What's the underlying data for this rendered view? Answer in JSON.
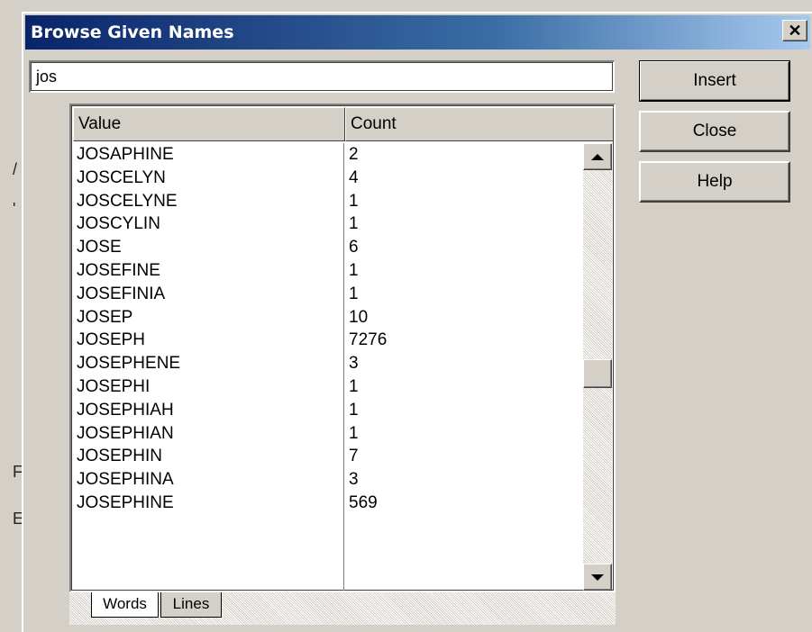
{
  "window": {
    "title": "Browse Given Names",
    "close_glyph": "✕"
  },
  "search": {
    "value": "jos"
  },
  "buttons": {
    "insert": "Insert",
    "close": "Close",
    "help": "Help"
  },
  "table": {
    "columns": [
      "Value",
      "Count"
    ],
    "rows": [
      [
        "JOSAPHINE",
        "2"
      ],
      [
        "JOSCELYN",
        "4"
      ],
      [
        "JOSCELYNE",
        "1"
      ],
      [
        "JOSCYLIN",
        "1"
      ],
      [
        "JOSE",
        "6"
      ],
      [
        "JOSEFINE",
        "1"
      ],
      [
        "JOSEFINIA",
        "1"
      ],
      [
        "JOSEP",
        "10"
      ],
      [
        "JOSEPH",
        "7276"
      ],
      [
        "JOSEPHENE",
        "3"
      ],
      [
        "JOSEPHI",
        "1"
      ],
      [
        "JOSEPHIAH",
        "1"
      ],
      [
        "JOSEPHIAN",
        "1"
      ],
      [
        "JOSEPHIN",
        "7"
      ],
      [
        "JOSEPHINA",
        "3"
      ],
      [
        "JOSEPHINE",
        "569"
      ]
    ]
  },
  "tabs": [
    {
      "label": "Words",
      "active": true
    },
    {
      "label": "Lines",
      "active": false
    }
  ],
  "background_glyphs": [
    "/",
    "'",
    "F",
    "E"
  ],
  "colors": {
    "title_start": "#0a246a",
    "title_end": "#a6caf0",
    "face": "#d4d0c8"
  }
}
